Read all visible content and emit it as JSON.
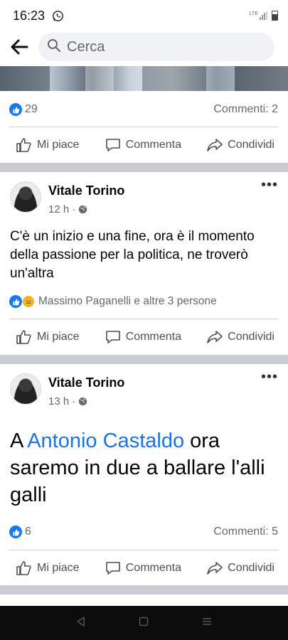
{
  "status": {
    "time": "16:23",
    "network": "LTE"
  },
  "search": {
    "placeholder": "Cerca"
  },
  "actions": {
    "like": "Mi piace",
    "comment": "Commenta",
    "share": "Condividi"
  },
  "post0": {
    "likes": "29",
    "comments": "Commenti: 2"
  },
  "post1": {
    "author": "Vitale Torino",
    "time": "12 h",
    "body": "C'è un inizio e una fine, ora è il momento della passione per la politica, ne troverò un'altra",
    "reactions": "Massimo Paganelli e altre 3 persone"
  },
  "post2": {
    "author": "Vitale Torino",
    "time": "13 h",
    "body_pre": "A ",
    "mention": "Antonio Castaldo",
    "body_post": " ora saremo in due a ballare l'alli galli",
    "likes": "6",
    "comments": "Commenti: 5"
  },
  "colors": {
    "accent": "#1877f2",
    "mention": "#1a73e8",
    "separator": "#c9ccd1"
  }
}
